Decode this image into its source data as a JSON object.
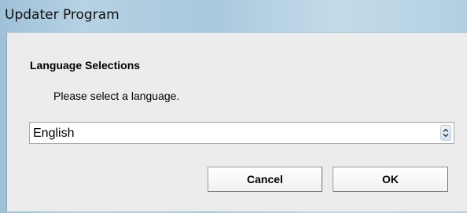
{
  "window": {
    "title": "Updater Program"
  },
  "dialog": {
    "heading": "Language Selections",
    "prompt": "Please select a language.",
    "language_select": {
      "selected": "English"
    },
    "buttons": {
      "cancel_label": "Cancel",
      "ok_label": "OK"
    }
  },
  "icons": {
    "select_arrows": "up-down-chevron-icon"
  }
}
